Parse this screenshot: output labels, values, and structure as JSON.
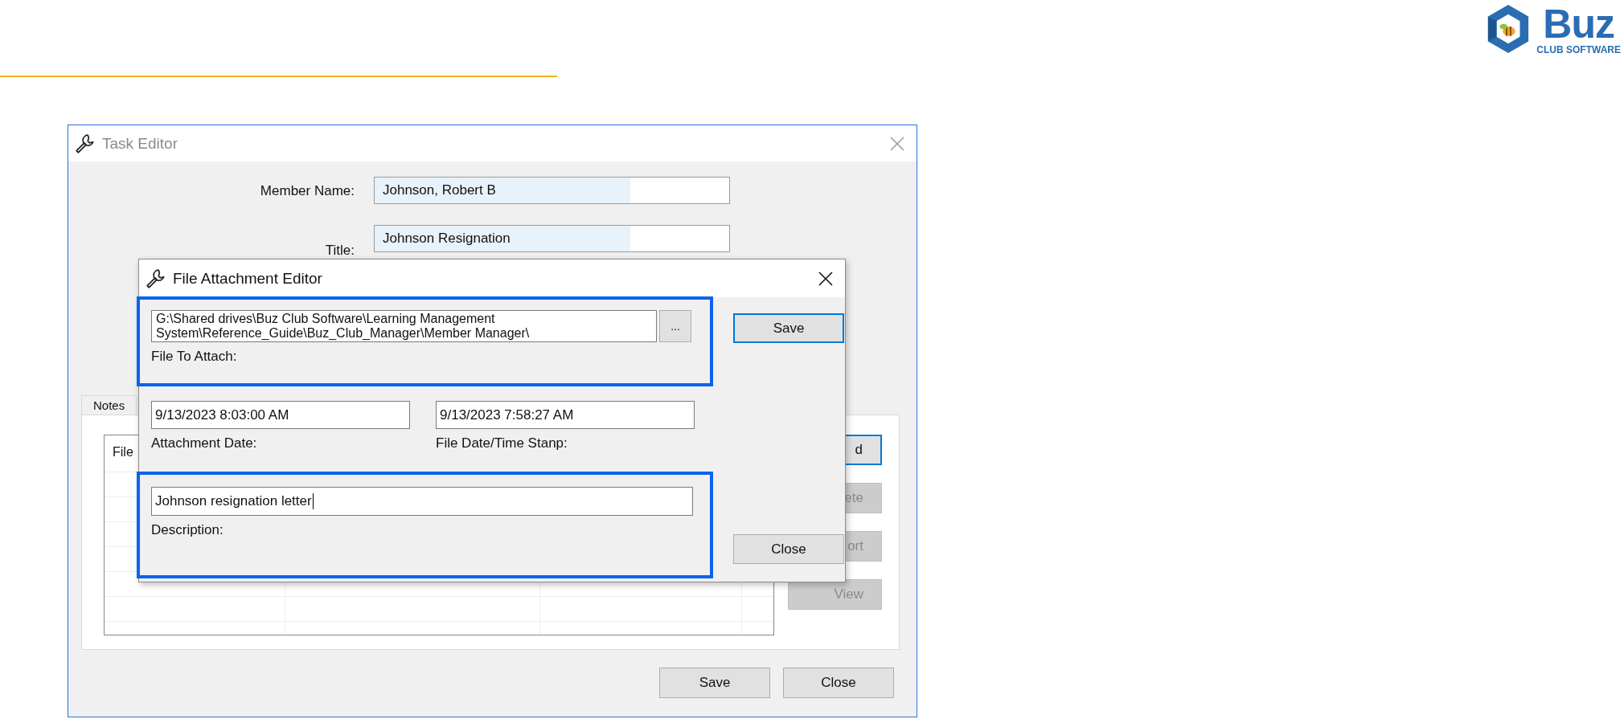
{
  "header": {
    "logo": {
      "name": "Buz",
      "tagline": "CLUB SOFTWARE"
    }
  },
  "task_editor": {
    "title": "Task Editor",
    "active": false,
    "fields": [
      {
        "label": "Member Name:",
        "value": "Johnson, Robert B"
      },
      {
        "label": "Title:",
        "value": "Johnson Resignation"
      }
    ],
    "tabs": [
      {
        "label": "Notes",
        "selected": false
      }
    ],
    "list": {
      "columns": [
        "File"
      ]
    },
    "side_buttons": [
      {
        "label": "d",
        "disabled": false,
        "focused": true
      },
      {
        "label": "ete",
        "disabled": true,
        "focused": false
      },
      {
        "label": "ort",
        "disabled": true,
        "focused": false
      },
      {
        "label": "View",
        "disabled": true,
        "focused": false
      }
    ],
    "buttons": [
      {
        "label": "Save"
      },
      {
        "label": "Close"
      }
    ]
  },
  "dialog": {
    "title": "File Attachment Editor",
    "file_path_lines": [
      "G:\\Shared drives\\Buz Club Software\\Learning Management",
      "System\\Reference_Guide\\Buz_Club_Manager\\Member Manager\\"
    ],
    "browse_label": "...",
    "file_label": "File To Attach:",
    "dates": [
      {
        "value": "9/13/2023 8:03:00 AM",
        "label": "Attachment Date:"
      },
      {
        "value": "9/13/2023 7:58:27 AM",
        "label": "File Date/Time Stanp:"
      }
    ],
    "description": {
      "value": "Johnson resignation letter",
      "label": "Description:"
    },
    "buttons": [
      {
        "label": "Save",
        "focused": true
      },
      {
        "label": "Close",
        "focused": false
      }
    ]
  }
}
